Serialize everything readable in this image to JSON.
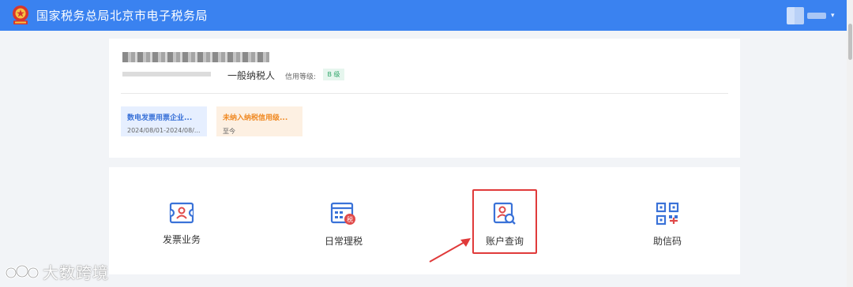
{
  "header": {
    "title": "国家税务总局北京市电子税务局",
    "user_menu_icon": "chevron-down-icon"
  },
  "company": {
    "taxpayer_type": "一般纳税人",
    "credit_label": "信用等级:",
    "credit_level": "B 级"
  },
  "notices": [
    {
      "title": "数电发票用票企业...",
      "subtitle": "2024/08/01-2024/08/...",
      "color": "#3a72d8"
    },
    {
      "title": "未纳入纳税信用级...",
      "subtitle": "至今",
      "color": "#f08a24"
    }
  ],
  "functions": [
    {
      "label": "发票业务",
      "icon": "invoice-icon"
    },
    {
      "label": "日常理税",
      "icon": "tax-calendar-icon"
    },
    {
      "label": "账户查询",
      "icon": "account-search-icon"
    },
    {
      "label": "助信码",
      "icon": "qr-code-icon"
    }
  ],
  "annotation": {
    "highlighted": "账户查询",
    "color": "#e03a3a"
  },
  "watermark": {
    "text": "大数跨境"
  },
  "colors": {
    "topbar": "#3a82f0",
    "accent": "#3a72d8",
    "background": "#f2f4f7"
  }
}
